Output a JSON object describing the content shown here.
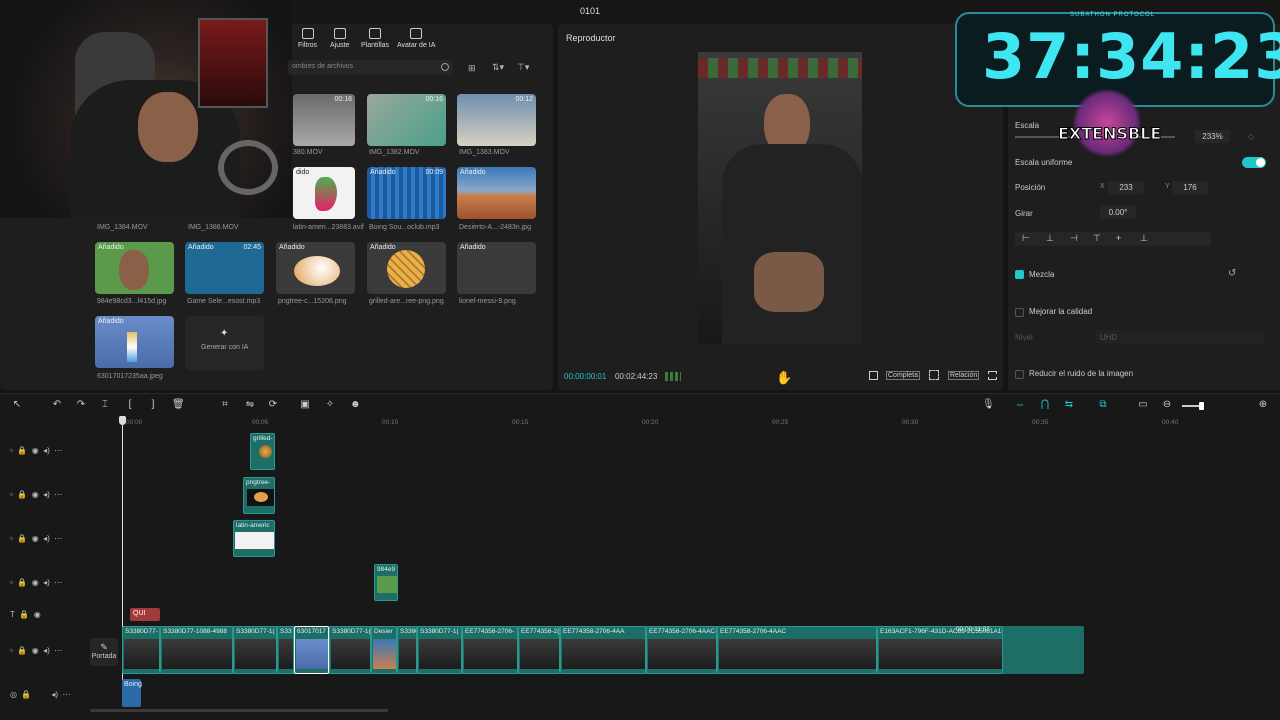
{
  "window": {
    "title": "0101"
  },
  "toolbar": {
    "tabs": [
      {
        "label": "Filtros",
        "icon": "filter-icon"
      },
      {
        "label": "Ajuste",
        "icon": "sliders-icon"
      },
      {
        "label": "Plantillas",
        "icon": "template-icon"
      },
      {
        "label": "Avatar de IA",
        "icon": "avatar-icon"
      }
    ]
  },
  "media": {
    "search_placeholder": "ombres de archivos",
    "items": [
      {
        "name": "380.MOV",
        "duration": "00:16",
        "badge": ""
      },
      {
        "name": "IMG_1382.MOV",
        "duration": "00:16",
        "badge": ""
      },
      {
        "name": "IMG_1383.MOV",
        "duration": "00:12",
        "badge": ""
      },
      {
        "name": "IMG_1384.MOV",
        "duration": "",
        "badge": ""
      },
      {
        "name": "IMG_1386.MOV",
        "duration": "",
        "badge": ""
      },
      {
        "name": "latin-ameri...23883.avif",
        "duration": "",
        "badge": "dido"
      },
      {
        "name": "Boing Sou...oclub.mp3",
        "duration": "00:09",
        "badge": "Añadido"
      },
      {
        "name": "Desierto-A...-2483n.jpg",
        "duration": "",
        "badge": "Añadido"
      },
      {
        "name": "984e98cd3...f415d.jpg",
        "duration": "",
        "badge": "Añadido"
      },
      {
        "name": "Game Sele...esost.mp3",
        "duration": "02:45",
        "badge": "Añadido"
      },
      {
        "name": "pngtree-c...15206.png",
        "duration": "",
        "badge": "Añadido"
      },
      {
        "name": "grilled-are...ree-png.png",
        "duration": "",
        "badge": "Añadido"
      },
      {
        "name": "lionel-messi-9.png",
        "duration": "",
        "badge": "Añadido"
      },
      {
        "name": "63017017235aa.jpeg",
        "duration": "",
        "badge": "Añadido"
      }
    ],
    "generate_label": "Generar con IA"
  },
  "player": {
    "title": "Reproductor",
    "current_time": "00:00:00:01",
    "total_time": "00:02:44:23",
    "full_label": "Completa",
    "ratio_label": "Relación"
  },
  "overlay": {
    "timer": "37:34:23",
    "brand": "EXTENSBLE",
    "subtitle": "SUBATHON PROTOCOL"
  },
  "inspector": {
    "scale_label": "Escala",
    "scale_value": "233%",
    "uniform_label": "Escala uniforme",
    "position_label": "Posición",
    "pos_x_label": "X",
    "pos_x": "233",
    "pos_y_label": "Y",
    "pos_y": "176",
    "rotate_label": "Girar",
    "rotate_value": "0.00°",
    "blend_label": "Mezcla",
    "enhance_label": "Mejorar la calidad",
    "level_label": "Nivel",
    "level_value": "UHD",
    "denoise_label": "Reducir el ruido de la imagen"
  },
  "timeline": {
    "ruler": [
      "00:00",
      "00:05",
      "00:10",
      "00:15",
      "00:20",
      "00:25",
      "00:30",
      "00:35",
      "00:40"
    ],
    "cover_label": "Portada",
    "text_clip": "QUI",
    "overlay_clips": [
      "grilled-",
      "pngtree-",
      "latin-americ",
      "984e9"
    ],
    "main_clips": [
      "S3380D77-",
      "S3380D77-1088-4988",
      "S3380D77-1(",
      "S33",
      "63017017",
      "S3380D77-1(",
      "Desier",
      "S3380(",
      "S3380D77-1(",
      "EE774358-2706-",
      "EE774358-2(",
      "EE774358-2706-4AA",
      "EE774358-2706-4AAC-AE",
      "EE774358-2706-4AAC",
      "E163ACF1-796F-431D-AC89-2C55081A1F1A.mov",
      "00:00:11:02"
    ],
    "audio_clip": "Boing"
  },
  "colors": {
    "accent": "#22c7cc",
    "clip": "#1d6e67",
    "timer": "#3fe6f0"
  }
}
